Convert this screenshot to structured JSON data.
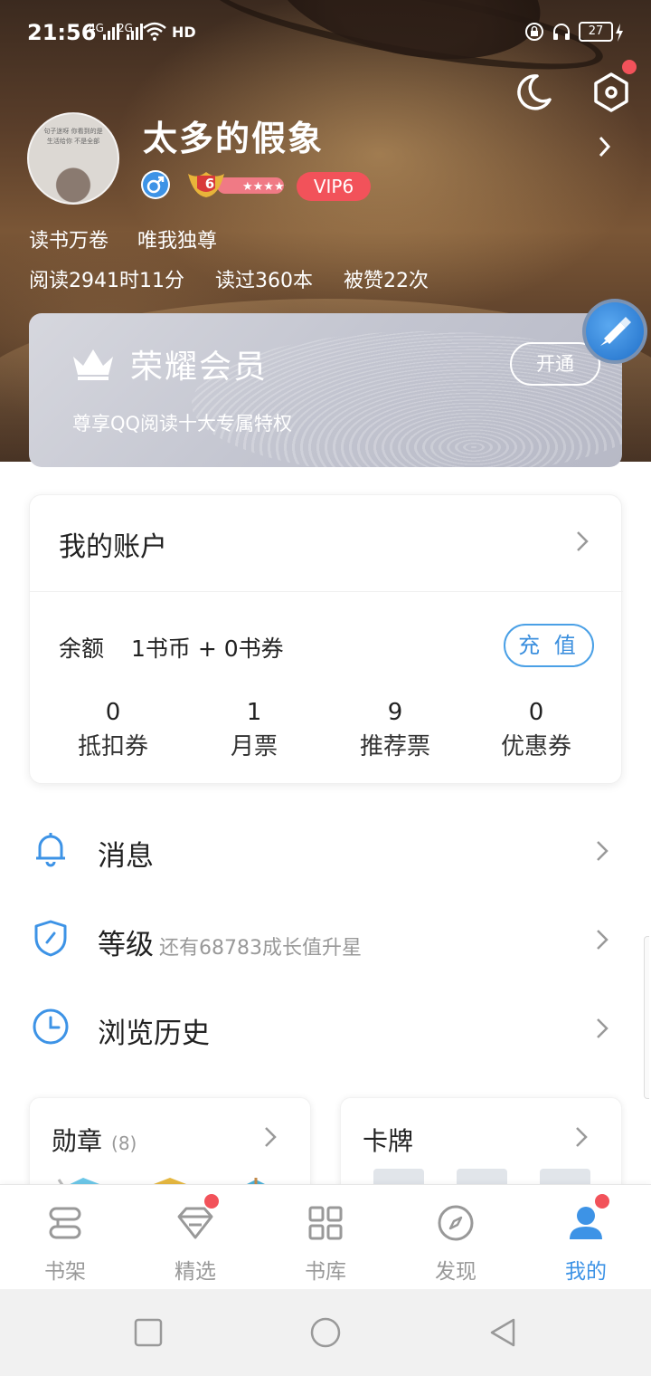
{
  "status_bar": {
    "time": "21:56",
    "network_1": "4G",
    "network_2": "2G",
    "hd_label": "HD",
    "battery": "27"
  },
  "profile": {
    "username": "太多的假象",
    "level": "6",
    "vip_label": "VIP6",
    "avatar_text": "句子迷呀 你看到的是生活给你 不是全部",
    "tags": [
      "读书万卷",
      "唯我独尊"
    ],
    "stats": [
      "阅读2941时11分",
      "读过360本",
      "被赞22次"
    ]
  },
  "membership": {
    "title": "荣耀会员",
    "subtitle": "尊享QQ阅读十大专属特权",
    "open_label": "开通"
  },
  "account": {
    "title": "我的账户",
    "balance_label": "余额",
    "balance_value": "1书币 + 0书券",
    "recharge_label": "充 值",
    "stats": [
      {
        "value": "0",
        "label": "抵扣券"
      },
      {
        "value": "1",
        "label": "月票"
      },
      {
        "value": "9",
        "label": "推荐票"
      },
      {
        "value": "0",
        "label": "优惠券"
      }
    ]
  },
  "menu": [
    {
      "label": "消息",
      "sub": "",
      "icon": "bell-icon"
    },
    {
      "label": "等级",
      "sub": "还有68783成长值升星",
      "icon": "shield-icon"
    },
    {
      "label": "浏览历史",
      "sub": "",
      "icon": "clock-icon"
    }
  ],
  "cards": {
    "medals_title": "勋章",
    "medals_count": "(8)",
    "cards_title": "卡牌"
  },
  "tabs": [
    {
      "label": "书架",
      "icon": "bookshelf-icon"
    },
    {
      "label": "精选",
      "icon": "diamond-icon"
    },
    {
      "label": "书库",
      "icon": "grid-icon"
    },
    {
      "label": "发现",
      "icon": "compass-icon"
    },
    {
      "label": "我的",
      "icon": "user-icon"
    }
  ],
  "colors": {
    "accent": "#3d93e6",
    "badge_red": "#f2525a",
    "member_card": "#c3c5d0"
  }
}
